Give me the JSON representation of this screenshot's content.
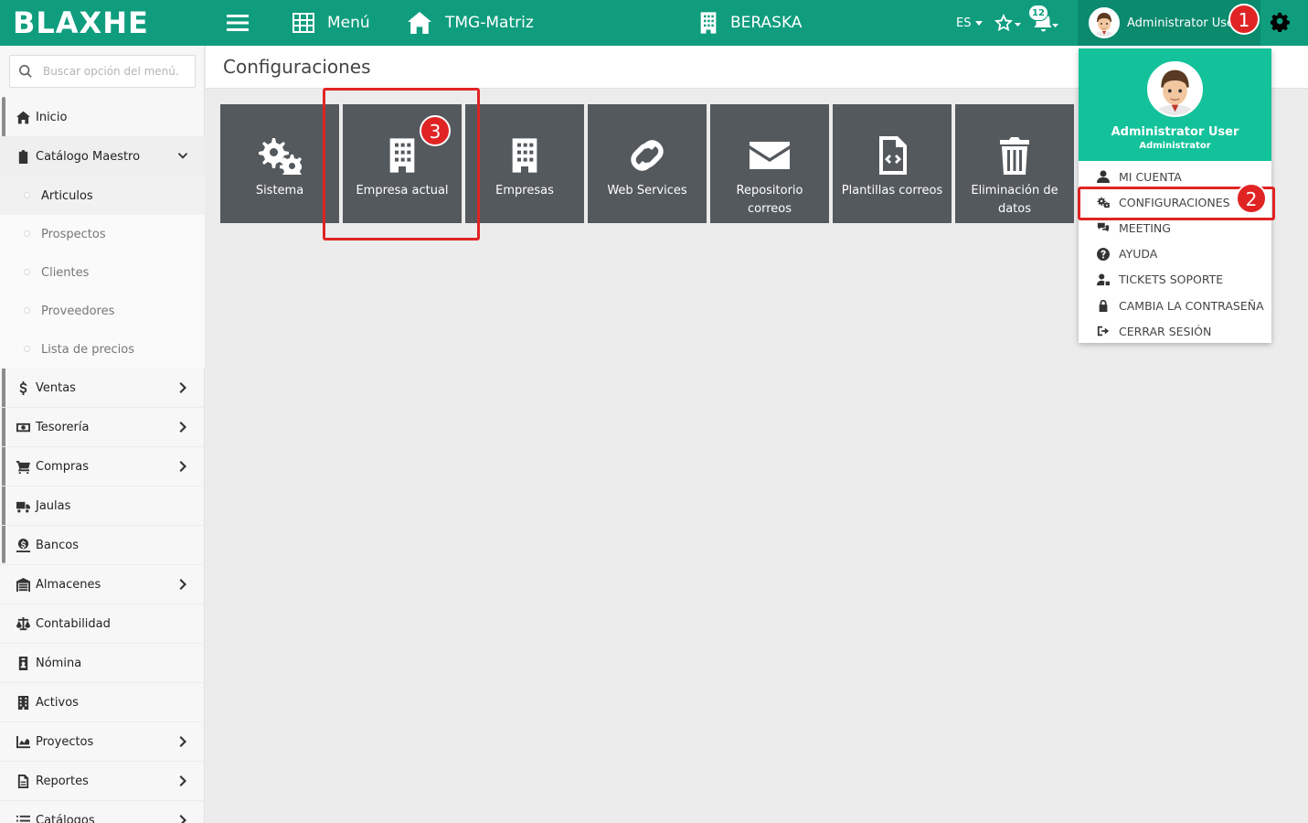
{
  "brand": "BLAXHE",
  "topbar": {
    "menu_label": "Menú",
    "home_label": "TMG-Matriz",
    "company_label": "BERASKA",
    "lang_label": "ES",
    "notifications_count": "12",
    "user_label": "Administrator Use"
  },
  "annotations": [
    "1",
    "2",
    "3"
  ],
  "search": {
    "placeholder": "Buscar opción del menú..."
  },
  "sidebar": {
    "items": [
      {
        "label": "Inicio"
      },
      {
        "label": "Catálogo Maestro"
      },
      {
        "label": "Ventas"
      },
      {
        "label": "Tesorería"
      },
      {
        "label": "Compras"
      },
      {
        "label": "Jaulas"
      },
      {
        "label": "Bancos"
      },
      {
        "label": "Almacenes"
      },
      {
        "label": "Contabilidad"
      },
      {
        "label": "Nómina"
      },
      {
        "label": "Activos"
      },
      {
        "label": "Proyectos"
      },
      {
        "label": "Reportes"
      },
      {
        "label": "Catálogos"
      }
    ],
    "subitems": [
      {
        "label": "Articulos"
      },
      {
        "label": "Prospectos"
      },
      {
        "label": "Clientes"
      },
      {
        "label": "Proveedores"
      },
      {
        "label": "Lista de precios"
      }
    ]
  },
  "page": {
    "title": "Configuraciones"
  },
  "tiles": [
    {
      "label": "Sistema",
      "icon": "gears-icon"
    },
    {
      "label": "Empresa actual",
      "icon": "building-icon"
    },
    {
      "label": "Empresas",
      "icon": "building-icon"
    },
    {
      "label": "Web Services",
      "icon": "link-icon"
    },
    {
      "label": "Repositorio correos",
      "icon": "envelope-icon"
    },
    {
      "label": "Plantillas correos",
      "icon": "file-code-icon"
    },
    {
      "label": "Eliminación de datos",
      "icon": "trash-icon"
    }
  ],
  "dropdown": {
    "name": "Administrator User",
    "role": "Administrator",
    "items": [
      {
        "label": "MI CUENTA",
        "icon": "user-icon"
      },
      {
        "label": "CONFIGURACIONES",
        "icon": "gears-icon"
      },
      {
        "label": "MEETING",
        "icon": "comments-icon"
      },
      {
        "label": "AYUDA",
        "icon": "question-icon"
      },
      {
        "label": "TICKETS SOPORTE",
        "icon": "user-tag-icon"
      },
      {
        "label": "CAMBIA LA CONTRASEÑA",
        "icon": "lock-icon"
      },
      {
        "label": "CERRAR SESIÓN",
        "icon": "sign-out-icon"
      }
    ]
  },
  "colors": {
    "primary": "#0f9d7e",
    "tile": "#54595d",
    "accent_red": "#e02424",
    "dropdown_head": "#13c29a"
  }
}
